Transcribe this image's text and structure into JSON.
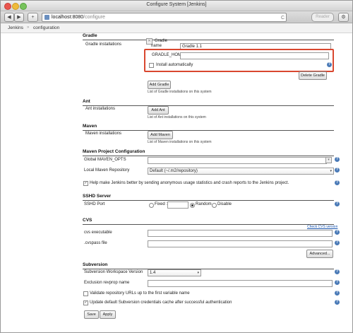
{
  "window": {
    "title": "Configure System [Jenkins]"
  },
  "toolbar": {
    "back": "◀",
    "forward": "▶",
    "add_tab": "+",
    "url_host": "localhost:8080",
    "url_path": "/configure",
    "reader": "Reader",
    "reload": "C",
    "right_btn": "⚙"
  },
  "breadcrumb": {
    "root": "Jenkins",
    "sep": "»",
    "current": "configuration"
  },
  "gradle": {
    "section": "Gradle",
    "installations_label": "Gradle installations",
    "name_label": "name",
    "top_label": "Gradle",
    "name_value": "Gradle 1.1",
    "home_label": "GRADLE_HOME",
    "home_value": "",
    "install_auto_label": "Install automatically",
    "delete_button": "Delete Gradle",
    "add_button": "Add Gradle",
    "list_note": "List of Gradle installations on this system"
  },
  "ant": {
    "section": "Ant",
    "installations_label": "Ant installations",
    "add_button": "Add Ant",
    "list_note": "List of Ant installations on this system"
  },
  "maven": {
    "section": "Maven",
    "installations_label": "Maven installations",
    "add_button": "Add Maven",
    "list_note": "List of Maven installations on this system"
  },
  "maven_project": {
    "section": "Maven Project Configuration",
    "global_opts_label": "Global MAVEN_OPTS",
    "global_opts_value": "",
    "local_repo_label": "Local Maven Repository",
    "local_repo_value": "Default (~/.m2/repository)",
    "usage_stats_label": "Help make Jenkins better by sending anonymous usage statistics and crash reports to the Jenkins project.",
    "usage_stats_checked": "✓"
  },
  "ssh": {
    "section": "SSHD Server",
    "port_label": "SSHD Port",
    "fixed_label": "Fixed :",
    "fixed_value": "",
    "random_label": "Random",
    "disable_label": "Disable"
  },
  "cvs": {
    "section": "CVS",
    "check_version_link": "Check CVS version",
    "executable_label": "cvs executable",
    "executable_value": "",
    "cvspass_label": ".cvspass file",
    "cvspass_value": "",
    "advanced_button": "Advanced..."
  },
  "subversion": {
    "section": "Subversion",
    "workspace_version_label": "Subversion Workspace Version",
    "workspace_version_value": "1.4",
    "exclusion_label": "Exclusion revprop name",
    "exclusion_value": "",
    "validate_label": "Validate repository URLs up to the first variable name",
    "update_default_label": "Update default Subversion credentials cache after successful authentication",
    "update_default_checked": "✓"
  },
  "footer": {
    "save": "Save",
    "apply": "Apply"
  },
  "icons": {
    "help": "?",
    "close": "✕",
    "chevron": "▾"
  },
  "colors": {
    "highlight": "#d9472f",
    "help": "#4a7ab7",
    "link": "#1a56b0"
  }
}
